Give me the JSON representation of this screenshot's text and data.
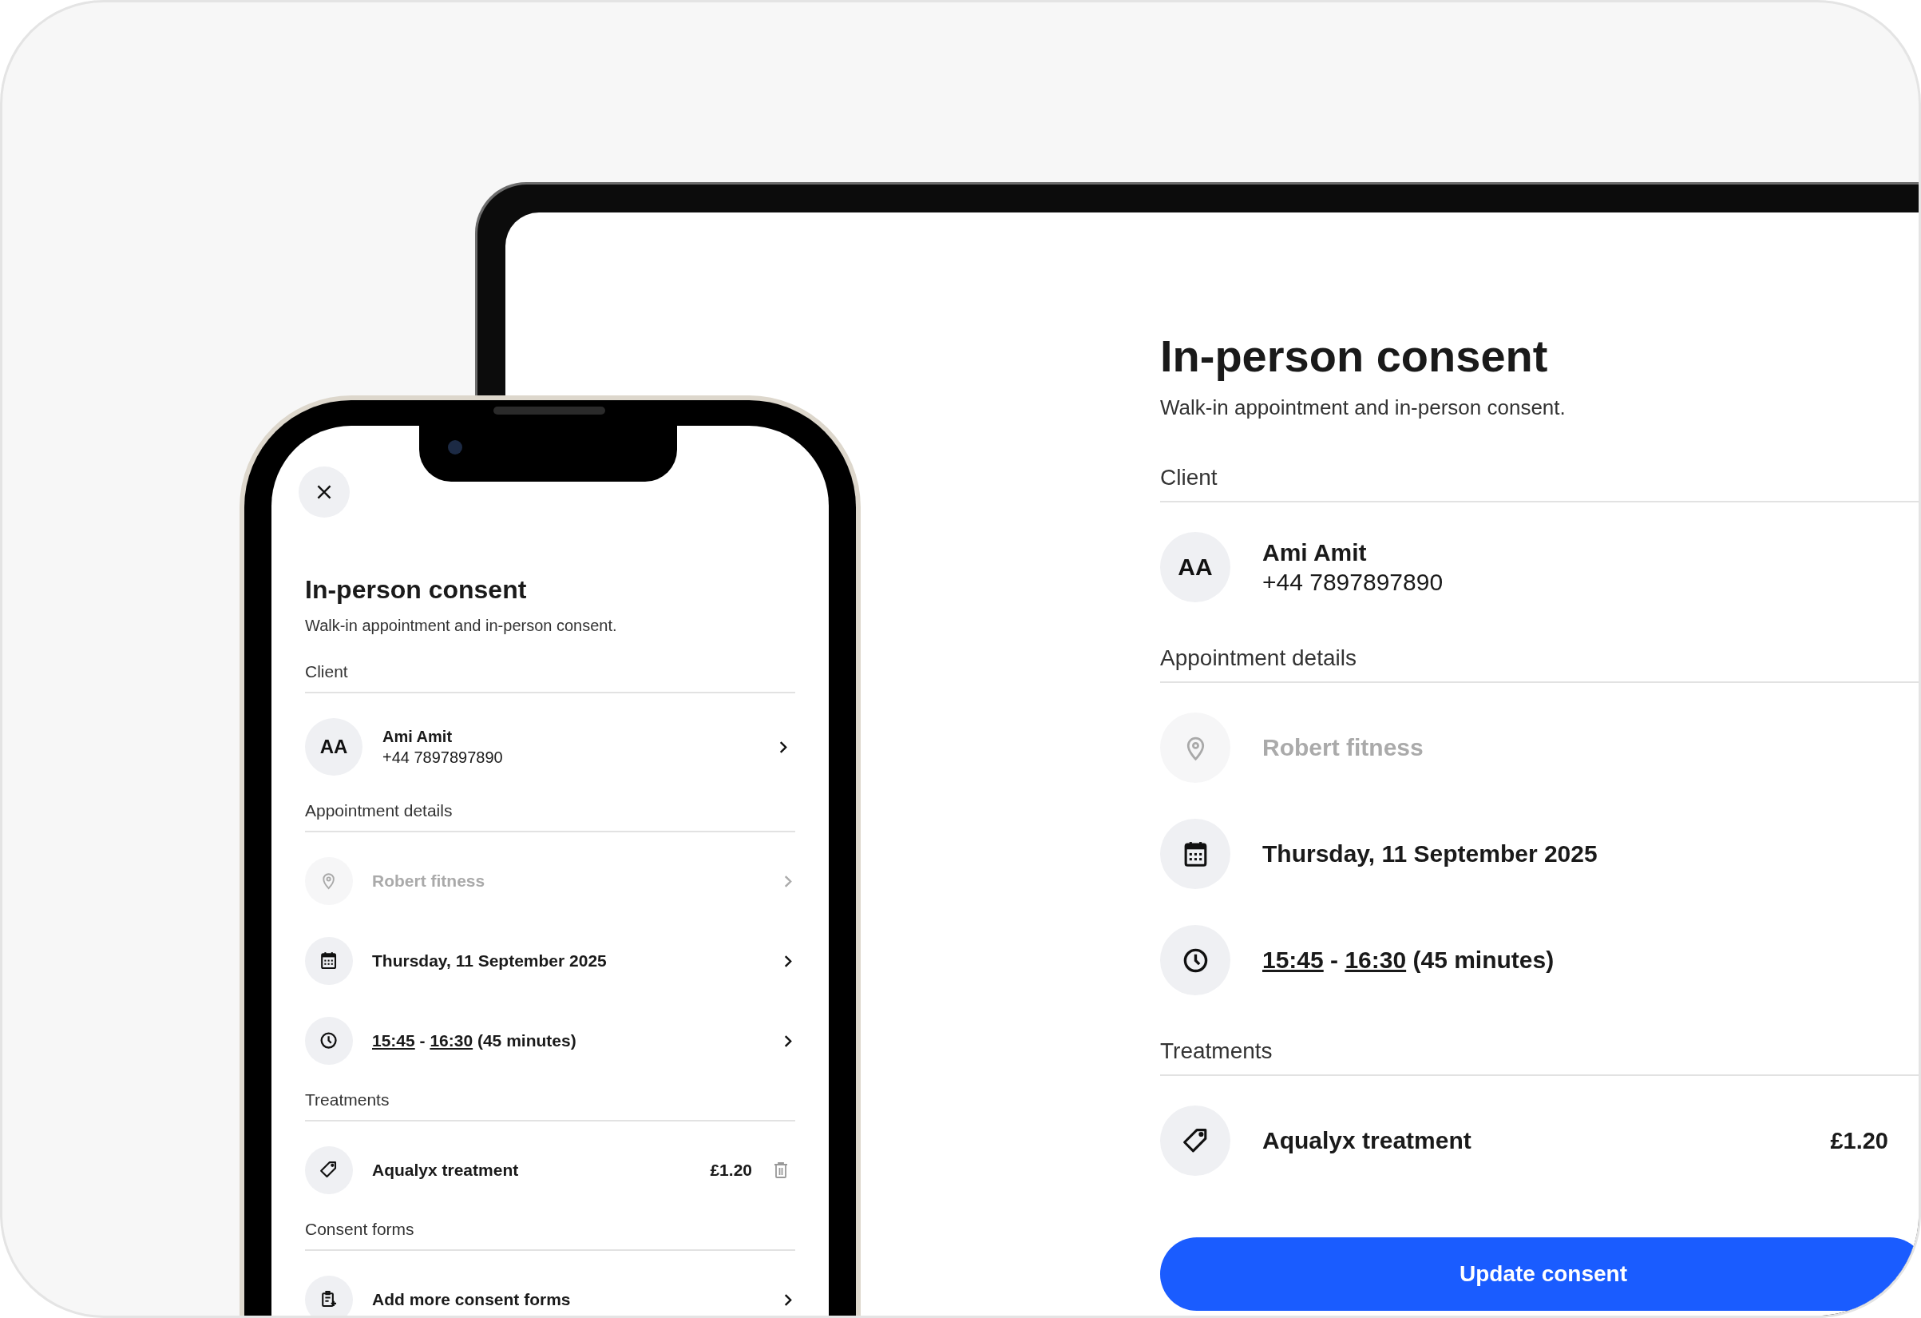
{
  "devices": [
    {
      "kind": "phone",
      "title": "In-person consent",
      "subtitle": "Walk-in appointment and in-person consent.",
      "sections": [
        {
          "heading": "Client",
          "rows": [
            {
              "kind": "client",
              "initials": "AA",
              "name": "Ami Amit",
              "phone": "+44 7897897890",
              "chevron": true,
              "disabled": false
            }
          ]
        },
        {
          "heading": "Appointment details",
          "rows": [
            {
              "kind": "location",
              "text": "Robert fitness",
              "chevron": true,
              "disabled": true
            },
            {
              "kind": "date",
              "text": "Thursday, 11 September 2025",
              "chevron": true,
              "disabled": false
            },
            {
              "kind": "time",
              "start": "15:45",
              "separator": "-",
              "end": "16:30",
              "duration": "(45 minutes)",
              "chevron": true,
              "disabled": false
            }
          ]
        },
        {
          "heading": "Treatments",
          "rows": [
            {
              "kind": "treatment",
              "text": "Aqualyx treatment",
              "price": "£1.20",
              "removable": true,
              "disabled": false
            }
          ]
        },
        {
          "heading": "Consent forms",
          "rows": [
            {
              "kind": "form",
              "text": "Add more consent forms",
              "chevron": true,
              "disabled": false
            }
          ]
        }
      ]
    },
    {
      "kind": "tablet",
      "title": "In-person consent",
      "subtitle": "Walk-in appointment and in-person consent.",
      "sections": [
        {
          "heading": "Client",
          "rows": [
            {
              "kind": "client",
              "initials": "AA",
              "name": "Ami Amit",
              "phone": "+44 7897897890",
              "disabled": false
            }
          ]
        },
        {
          "heading": "Appointment details",
          "rows": [
            {
              "kind": "location",
              "text": "Robert fitness",
              "disabled": true
            },
            {
              "kind": "date",
              "text": "Thursday, 11 September 2025",
              "disabled": false
            },
            {
              "kind": "time",
              "start": "15:45",
              "separator": "-",
              "end": "16:30",
              "duration": "(45 minutes)",
              "disabled": false
            }
          ]
        },
        {
          "heading": "Treatments",
          "rows": [
            {
              "kind": "treatment",
              "text": "Aqualyx treatment",
              "price": "£1.20",
              "disabled": false
            }
          ]
        }
      ],
      "primary_button": "Update consent"
    }
  ]
}
